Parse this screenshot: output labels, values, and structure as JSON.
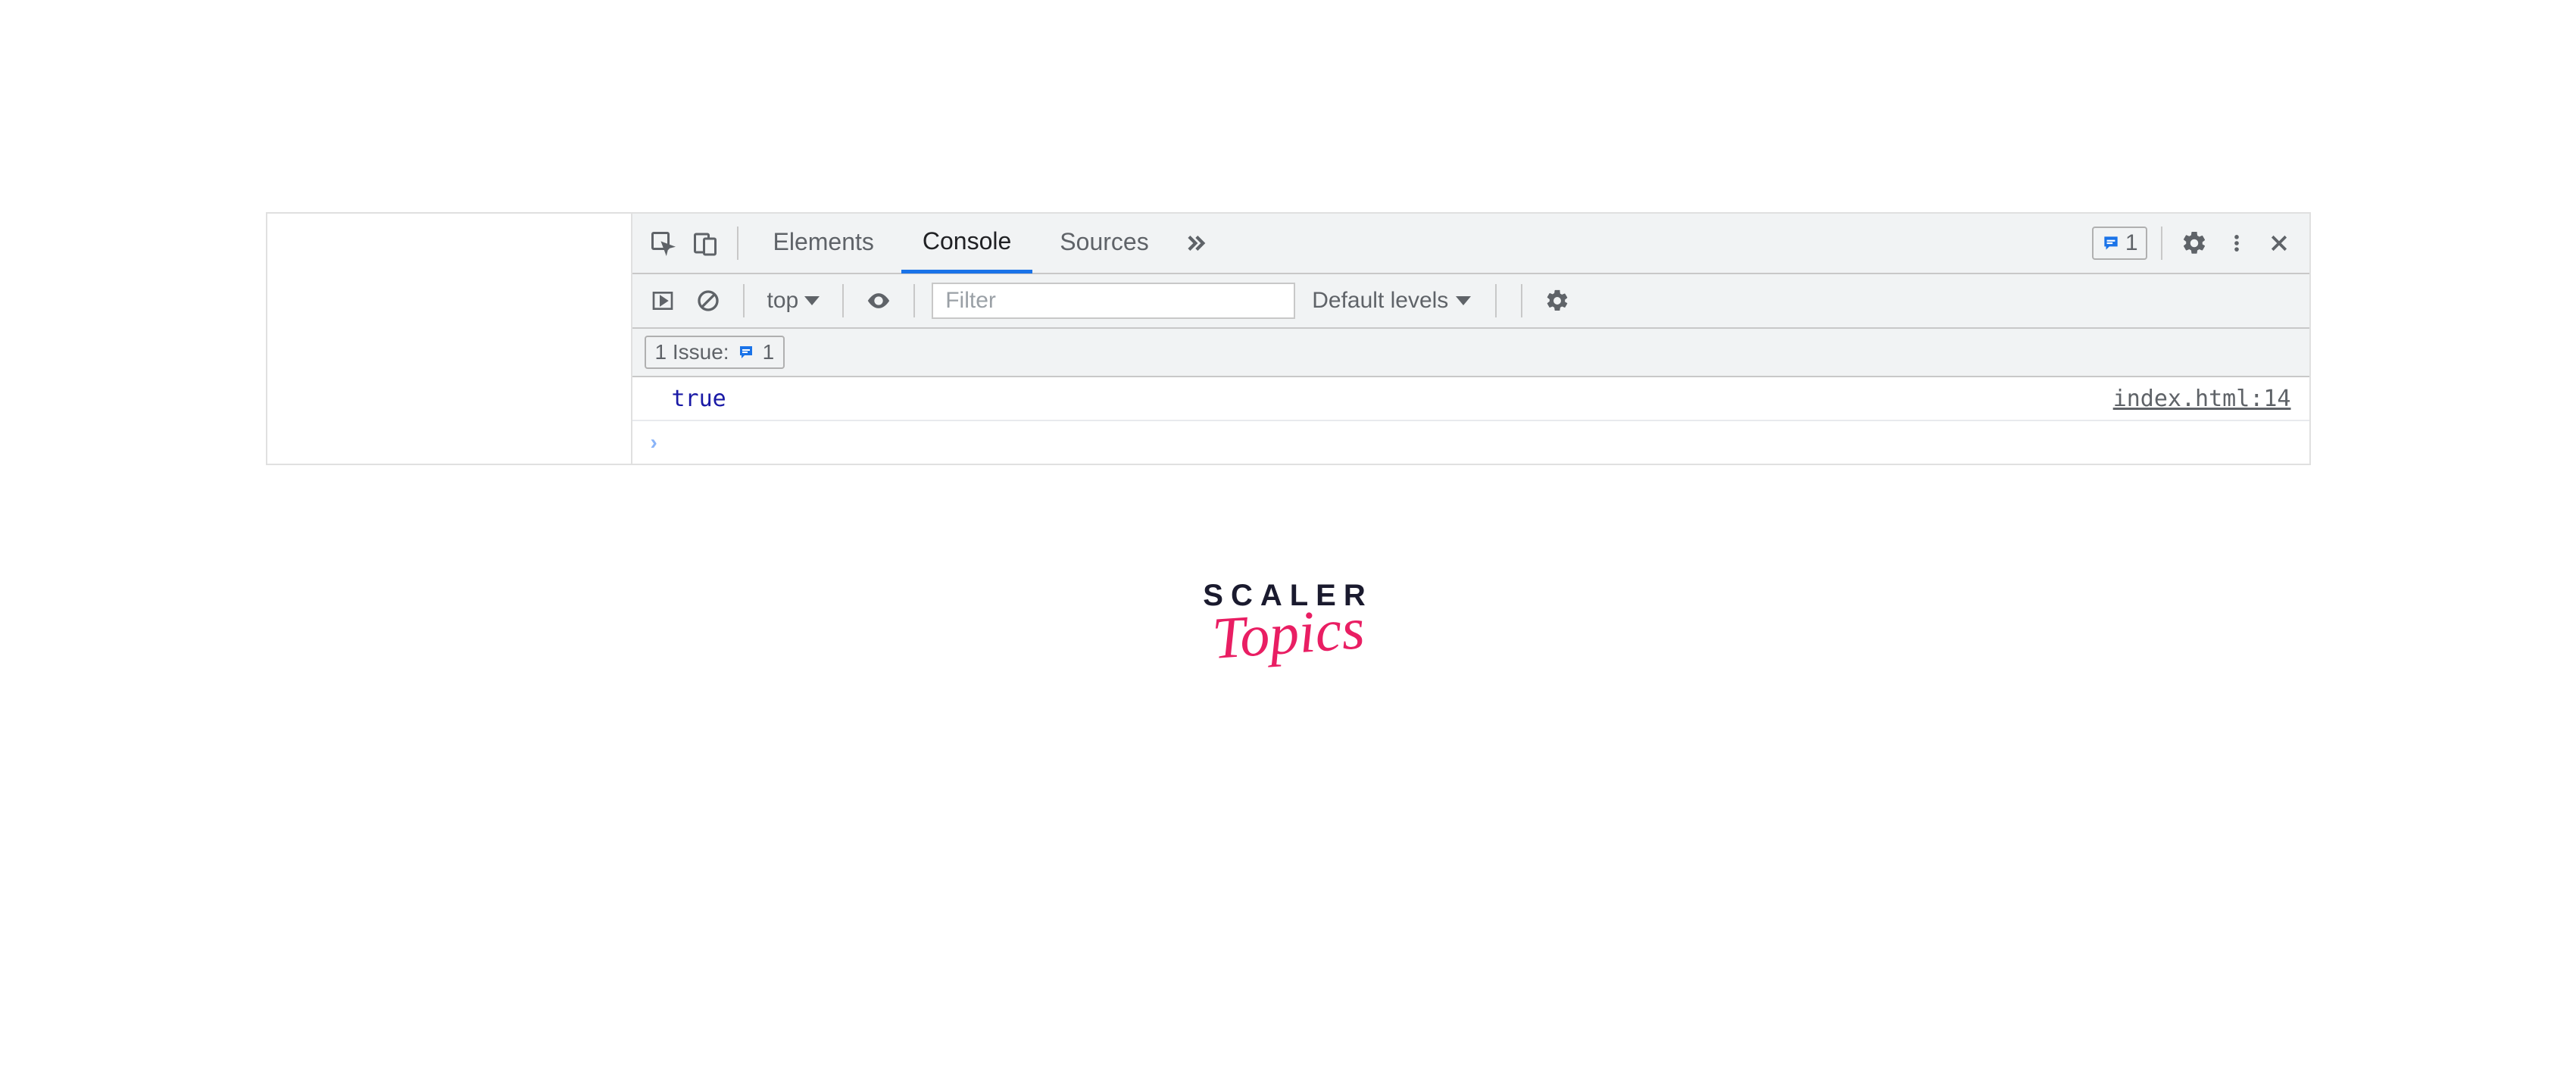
{
  "tabs": {
    "elements": "Elements",
    "console": "Console",
    "sources": "Sources"
  },
  "header": {
    "issue_count": "1"
  },
  "filter": {
    "context": "top",
    "placeholder": "Filter",
    "levels": "Default levels"
  },
  "issues": {
    "label": "1 Issue:",
    "count": "1"
  },
  "console": {
    "log_value": "true",
    "log_source": "index.html:14"
  },
  "logo": {
    "line1": "SCALER",
    "line2": "Topics"
  }
}
